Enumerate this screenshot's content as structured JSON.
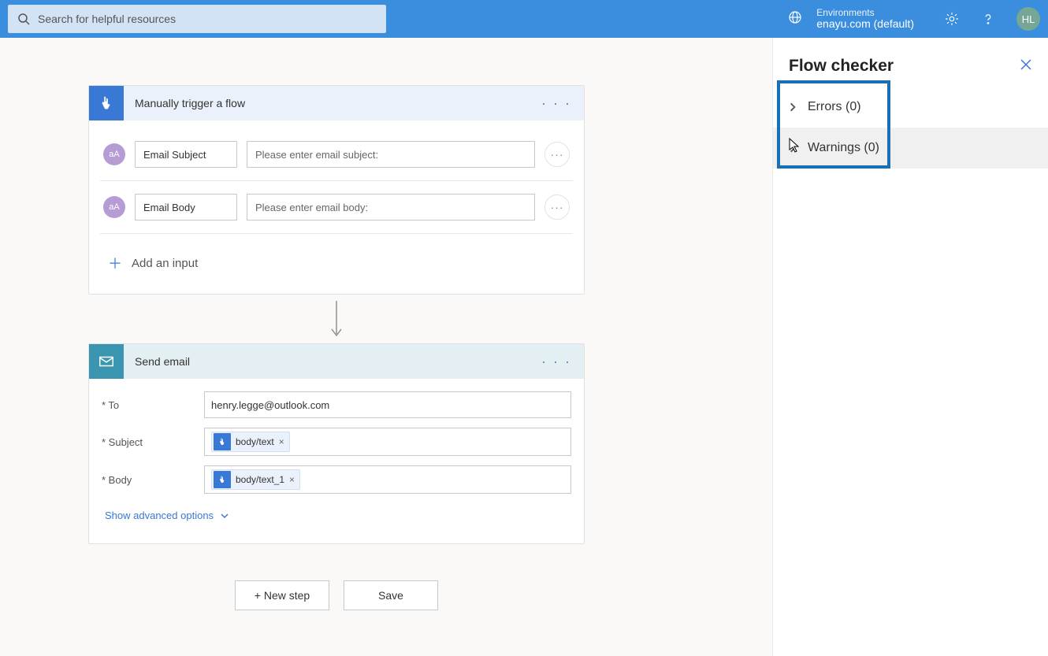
{
  "topbar": {
    "search_placeholder": "Search for helpful resources",
    "env_label": "Environments",
    "env_name": "enayu.com (default)",
    "avatar_initials": "HL"
  },
  "trigger_card": {
    "title": "Manually trigger a flow",
    "inputs": [
      {
        "name": "Email Subject",
        "placeholder": "Please enter email subject:"
      },
      {
        "name": "Email Body",
        "placeholder": "Please enter email body:"
      }
    ],
    "add_input_label": "Add an input"
  },
  "send_card": {
    "title": "Send email",
    "fields": {
      "to_label": "* To",
      "to_value": "henry.legge@outlook.com",
      "subject_label": "* Subject",
      "subject_token": "body/text",
      "body_label": "* Body",
      "body_token": "body/text_1"
    },
    "advanced_label": "Show advanced options"
  },
  "footer": {
    "new_step": "+ New step",
    "save": "Save"
  },
  "panel": {
    "title": "Flow checker",
    "errors_label": "Errors (0)",
    "warnings_label": "Warnings (0)"
  }
}
